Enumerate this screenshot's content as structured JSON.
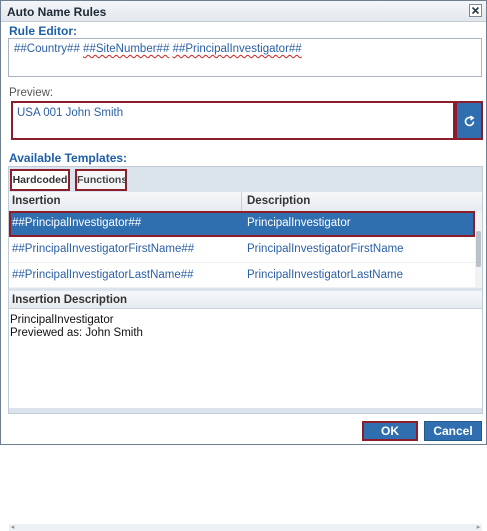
{
  "dialog": {
    "title": "Auto Name Rules"
  },
  "editor": {
    "label": "Rule Editor:",
    "tokens": [
      "##Country## ",
      "##SiteNumber##",
      " ",
      "##PrincipalInvestigator##"
    ]
  },
  "preview": {
    "label": "Preview:",
    "value": "USA 001 John Smith"
  },
  "templates": {
    "label": "Available Templates:",
    "tabs": [
      {
        "label": "Hardcoded"
      },
      {
        "label": "Functions"
      }
    ],
    "columns": [
      "Insertion",
      "Description"
    ],
    "rows": [
      {
        "insertion": "##PrincipalInvestigator##",
        "description": "PrincipalInvestigator",
        "selected": true
      },
      {
        "insertion": "##PrincipalInvestigatorFirstName##",
        "description": "PrincipalInvestigatorFirstName",
        "selected": false
      },
      {
        "insertion": "##PrincipalInvestigatorLastName##",
        "description": "PrincipalInvestigatorLastName",
        "selected": false
      }
    ],
    "insertion_description": {
      "heading": "Insertion Description",
      "lines": [
        "PrincipalInvestigator",
        "Previewed as: John Smith"
      ]
    }
  },
  "footer": {
    "ok_label": "OK",
    "cancel_label": "Cancel"
  },
  "colors": {
    "accent": "#2f6fb0",
    "highlight_border": "#8b1e2a",
    "link_text": "#2b5fa6",
    "section_label": "#1f5fa8"
  },
  "icons": {
    "close": "close-icon",
    "refresh": "refresh-icon"
  }
}
